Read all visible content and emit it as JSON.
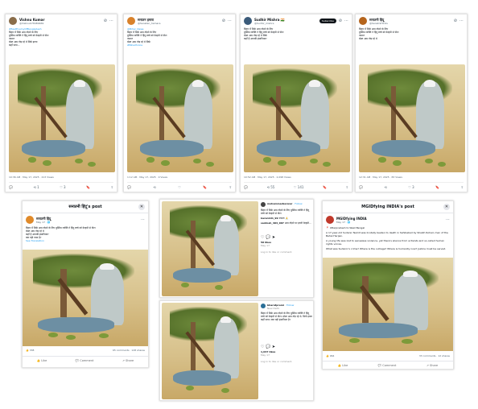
{
  "tweets": [
    {
      "name": "Vishnu Kumar",
      "handle": "@VishnuK78489469",
      "tag": "#BestEnemyOfBangladesh",
      "lines": [
        "बिहार में सिर्फ आम तोड़ने के लिए",
        "मुस्लिम व्यक्ति ने हिंदू बच्चे को बेरहमी से पीटा",
        "नफरत",
        "दोस्त आम तोड़ रहे थे सिर्फ इतना"
      ],
      "extra": "कहाँ पाया...",
      "meta": "10:36 AM · May 17, 2025 · 213 Views",
      "actions": [
        "💬",
        "⟲ 1",
        "♡ 3",
        "🔖",
        "⇪"
      ]
    },
    {
      "name": "सनातन हमारा",
      "handle": "@Sanatan_hamara",
      "tag": "@Bihar_News",
      "lines": [
        "बिहार में सिर्फ आम तोड़ने के लिए",
        "मुस्लिम व्यक्ति ने हिंदू बच्चे को बेरहमी से पीटा",
        "नफरत",
        "दोस्त आम तोड़ रहे थे सिर्फ"
      ],
      "extra": "#BiharPolice",
      "meta": "1:12 AM · May 17, 2025 · 9 Views",
      "actions": [
        "💬",
        "⟲",
        "♡",
        "🔖",
        "⇪"
      ]
    },
    {
      "name": "Sudhir Mishra 🇮🇳",
      "handle": "@Sudhir_mishra",
      "tag": "Subscribe",
      "lines": [
        "बिहार में सिर्फ आम तोड़ने के लिए",
        "मुस्लिम व्यक्ति ने हिंदू बच्चे को बेरहमी से पीटा",
        "दोस्त आम तोड़ रहे थे सिर्फ",
        "कहाँ है आपकी इंसानियत?"
      ],
      "extra": "",
      "meta": "10:52 AM · May 17, 2025 · 2,098 Views",
      "actions": [
        "💬",
        "⟲ 55",
        "♡ 141",
        "🔖",
        "⇪"
      ]
    },
    {
      "name": "सनातनी हिंदू",
      "handle": "@SanatniHindu",
      "tag": "",
      "lines": [
        "बिहार में सिर्फ आम तोड़ने के लिए",
        "मुस्लिम व्यक्ति ने हिंदू बच्चे को बेरहमी से पीटा",
        "नफरत",
        "दोस्त आम तोड़ रहे थे"
      ],
      "extra": "",
      "meta": "12:31 AM · May 17, 2025 · 83 Views",
      "actions": [
        "💬",
        "⟲",
        "♡ 3",
        "🔖",
        "⇪"
      ]
    }
  ],
  "fb1": {
    "title": "सनातनी हिंदू's post",
    "close": "✕",
    "name": "सनातनी हिंदू",
    "time": "May 17 · 🌐",
    "lines": [
      "बिहार में सिर्फ आम तोड़ने के लिए मुस्लिम व्यक्ति ने हिंदू बच्चे को बेरहमी से पीटा",
      "दोस्त आम तोड़ रहे थे",
      "कहाँ है आपकी इंसानियत?",
      "क्या यही न्याय है?"
    ],
    "see": "See Translation",
    "reactions": "👍 338",
    "counts": "65 comments · 128 shares",
    "btns": [
      "👍 Like",
      "💬 Comment",
      "↗ Share"
    ]
  },
  "ig1": {
    "user": "mohammadsarwar",
    "follow": "· Follow",
    "caption": "बिहार में सिर्फ आम तोड़ने के लिए मुस्लिम व्यक्ति ने हिंदू बच्चे को बेरहमी से पीटा",
    "c1user": "karan101_99",
    "c1": "नफरत 🙏",
    "c2user": "santosh_404_007",
    "c2": "आम तोड़ने पर इतनी बेरहमी...",
    "likes": "50 likes",
    "date": "May 17",
    "login": "Log in to like or comment."
  },
  "ig2": {
    "user": "bharatpremi",
    "follow": "· Follow",
    "sub": "New Delhi",
    "caption": "बिहार में सिर्फ आम तोड़ने के लिए मुस्लिम व्यक्ति ने हिंदू बच्चे को बेरहमी से पीटा। दोस्त आम तोड़ रहे थे, सिर्फ इतना कहाँ पाया। क्या यही इंसानियत है?",
    "likes": "1,047 likes",
    "date": "May 17",
    "login": "Log in to like or comment."
  },
  "fb2": {
    "title": "MGIDfying INDIA's post",
    "close": "✕",
    "name": "MGIDfying INDIA",
    "time": "May 17 · 🌐",
    "lines": [
      "📍 Uttarpradesh to West Bengal",
      "A 17-year-old Sudanic Namit was brutally beaten to death in Sahibabad by Shaikh Rohail, man of the Bahal Harijan.",
      "A young life was lost to senseless violence, yet there's silence from activists and so-called human rights voices.",
      "What was Sudanic's crime? Where is the outrage? Where is humanity now? Justice must be served."
    ],
    "reactions": "👍 964",
    "counts": "33 comments · 12 shares",
    "btns": [
      "👍 Like",
      "💬 Comment",
      "↗ Share"
    ]
  }
}
